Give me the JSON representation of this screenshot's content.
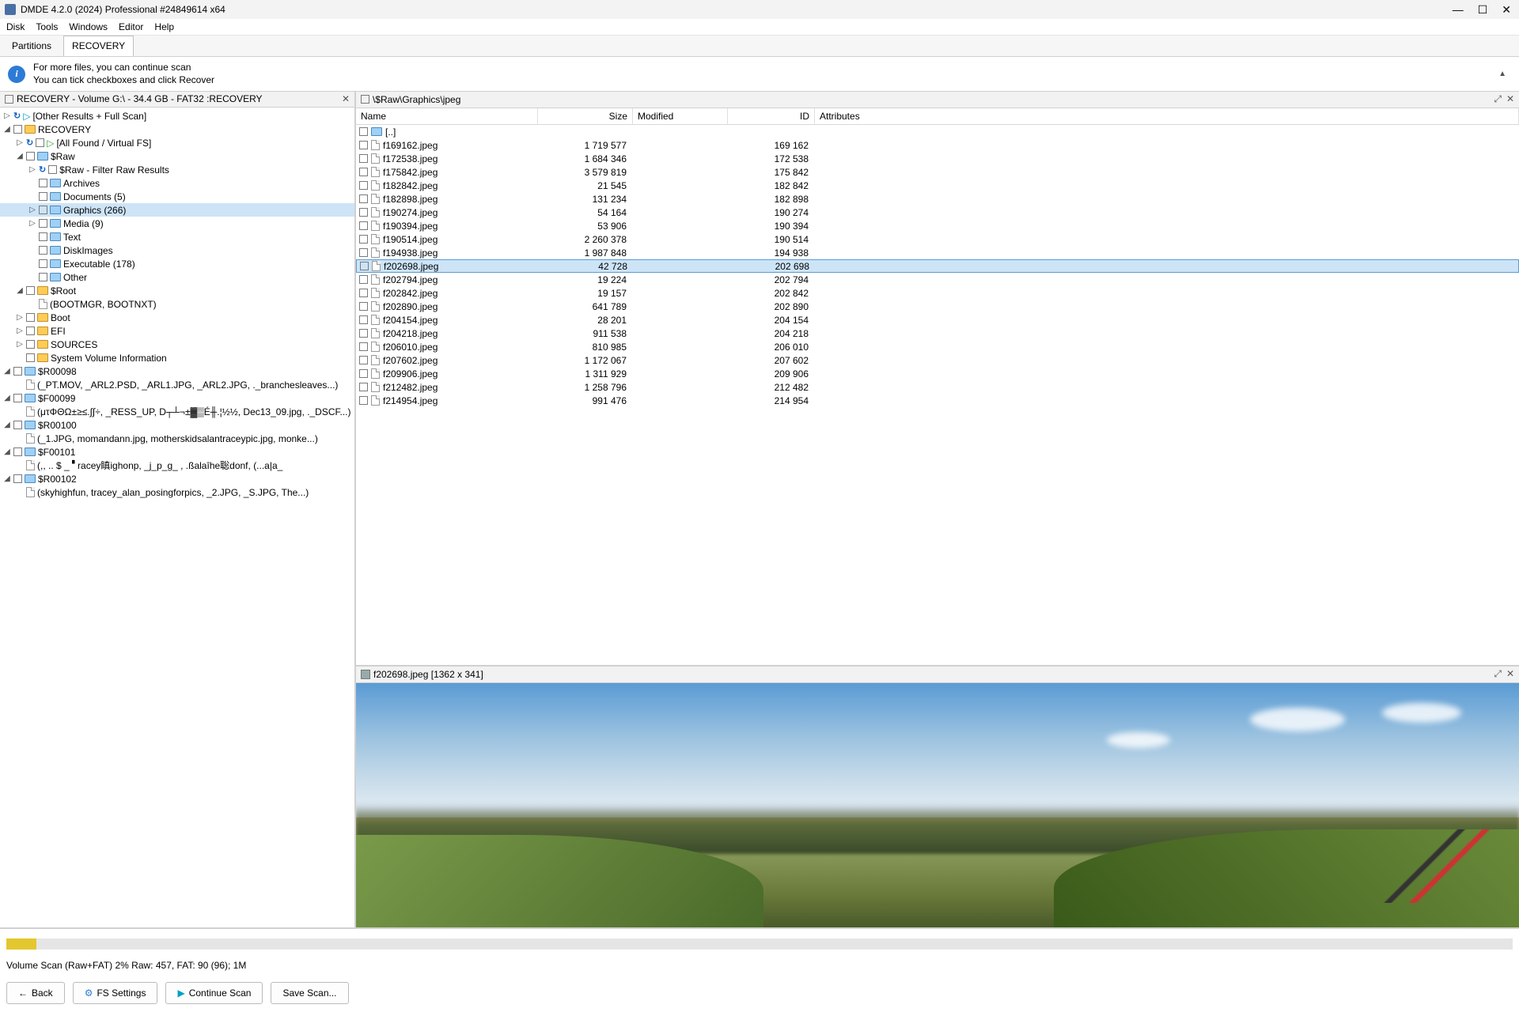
{
  "title": "DMDE 4.2.0 (2024) Professional #24849614 x64",
  "menu": [
    "Disk",
    "Tools",
    "Windows",
    "Editor",
    "Help"
  ],
  "tabs": [
    {
      "label": "Partitions",
      "active": false
    },
    {
      "label": "RECOVERY",
      "active": true
    }
  ],
  "info": {
    "line1": "For more files, you can continue scan",
    "line2": "You can tick checkboxes and click Recover"
  },
  "left": {
    "title": "RECOVERY - Volume G:\\ - 34.4 GB - FAT32 :RECOVERY",
    "rows": [
      {
        "d": 0,
        "t": "▷",
        "extras": [
          "refresh",
          "play"
        ],
        "label": "[Other Results + Full Scan]",
        "folder": false
      },
      {
        "d": 0,
        "t": "◢",
        "chk": true,
        "fld": "gold",
        "label": "RECOVERY"
      },
      {
        "d": 1,
        "t": "▷",
        "extras": [
          "refresh",
          "chk",
          "playg"
        ],
        "label": "[All Found / Virtual FS]"
      },
      {
        "d": 1,
        "t": "◢",
        "chk": true,
        "fld": "blue",
        "label": "$Raw"
      },
      {
        "d": 2,
        "t": "▷",
        "extras": [
          "refresh",
          "chk"
        ],
        "label": "$Raw - Filter Raw Results"
      },
      {
        "d": 2,
        "t": "",
        "chk": true,
        "fld": "blue",
        "label": "Archives"
      },
      {
        "d": 2,
        "t": "",
        "chk": true,
        "fld": "blue",
        "label": "Documents (5)"
      },
      {
        "d": 2,
        "t": "▷",
        "chk": true,
        "fld": "blue",
        "label": "Graphics (266)",
        "sel": true
      },
      {
        "d": 2,
        "t": "▷",
        "chk": true,
        "fld": "blue",
        "label": "Media (9)"
      },
      {
        "d": 2,
        "t": "",
        "chk": true,
        "fld": "blue",
        "label": "Text"
      },
      {
        "d": 2,
        "t": "",
        "chk": true,
        "fld": "blue",
        "label": "DiskImages"
      },
      {
        "d": 2,
        "t": "",
        "chk": true,
        "fld": "blue",
        "label": "Executable (178)"
      },
      {
        "d": 2,
        "t": "",
        "chk": true,
        "fld": "blue",
        "label": "Other"
      },
      {
        "d": 1,
        "t": "◢",
        "chk": true,
        "fld": "gold",
        "label": "$Root"
      },
      {
        "d": 2,
        "t": "",
        "doc": true,
        "label": "(BOOTMGR, BOOTNXT)"
      },
      {
        "d": 1,
        "t": "▷",
        "chk": true,
        "fld": "gold",
        "label": "Boot"
      },
      {
        "d": 1,
        "t": "▷",
        "chk": true,
        "fld": "gold",
        "label": "EFI"
      },
      {
        "d": 1,
        "t": "▷",
        "chk": true,
        "fld": "gold",
        "label": "SOURCES"
      },
      {
        "d": 1,
        "t": "",
        "chk": true,
        "fld": "gold",
        "label": "System Volume Information"
      },
      {
        "d": 0,
        "t": "◢",
        "chk": true,
        "fld": "blue",
        "label": "$R00098"
      },
      {
        "d": 1,
        "t": "",
        "doc": true,
        "label": "(_PT.MOV, _ARL2.PSD, _ARL1.JPG, _ARL2.JPG, ._branchesleaves...)"
      },
      {
        "d": 0,
        "t": "◢",
        "chk": true,
        "fld": "blue",
        "label": "$F00099"
      },
      {
        "d": 1,
        "t": "",
        "doc": true,
        "label": "(μτΦΘΩ±≥≤.∫∫÷, _RESS_UP, D┬┴¬±▓▒É╫.¦½½, Dec13_09.jpg, ._DSCF...)"
      },
      {
        "d": 0,
        "t": "◢",
        "chk": true,
        "fld": "blue",
        "label": "$R00100"
      },
      {
        "d": 1,
        "t": "",
        "doc": true,
        "label": "(_1.JPG, momandann.jpg, motherskidsalantraceypic.jpg, monke...)"
      },
      {
        "d": 0,
        "t": "◢",
        "chk": true,
        "fld": "blue",
        "label": "$F00101"
      },
      {
        "d": 1,
        "t": "",
        "doc": true,
        "label": "(,, .. $ _ 🬀racey瞋ighonp, _j_p_g_ , .ßalaîhe聡donf, (...a|a_"
      },
      {
        "d": 0,
        "t": "◢",
        "chk": true,
        "fld": "blue",
        "label": "$R00102"
      },
      {
        "d": 1,
        "t": "",
        "doc": true,
        "label": "(skyhighfun, tracey_alan_posingforpics, _2.JPG, _S.JPG, The...)"
      }
    ]
  },
  "right": {
    "title": "\\$Raw\\Graphics\\jpeg",
    "cols": {
      "name": "Name",
      "size": "Size",
      "modified": "Modified",
      "id": "ID",
      "attr": "Attributes"
    },
    "uplabel": "[..]",
    "files": [
      {
        "name": "f169162.jpeg",
        "size": "1 719 577",
        "id": "169 162"
      },
      {
        "name": "f172538.jpeg",
        "size": "1 684 346",
        "id": "172 538"
      },
      {
        "name": "f175842.jpeg",
        "size": "3 579 819",
        "id": "175 842"
      },
      {
        "name": "f182842.jpeg",
        "size": "21 545",
        "id": "182 842"
      },
      {
        "name": "f182898.jpeg",
        "size": "131 234",
        "id": "182 898"
      },
      {
        "name": "f190274.jpeg",
        "size": "54 164",
        "id": "190 274"
      },
      {
        "name": "f190394.jpeg",
        "size": "53 906",
        "id": "190 394"
      },
      {
        "name": "f190514.jpeg",
        "size": "2 260 378",
        "id": "190 514"
      },
      {
        "name": "f194938.jpeg",
        "size": "1 987 848",
        "id": "194 938"
      },
      {
        "name": "f202698.jpeg",
        "size": "42 728",
        "id": "202 698",
        "sel": true
      },
      {
        "name": "f202794.jpeg",
        "size": "19 224",
        "id": "202 794"
      },
      {
        "name": "f202842.jpeg",
        "size": "19 157",
        "id": "202 842"
      },
      {
        "name": "f202890.jpeg",
        "size": "641 789",
        "id": "202 890"
      },
      {
        "name": "f204154.jpeg",
        "size": "28 201",
        "id": "204 154"
      },
      {
        "name": "f204218.jpeg",
        "size": "911 538",
        "id": "204 218"
      },
      {
        "name": "f206010.jpeg",
        "size": "810 985",
        "id": "206 010"
      },
      {
        "name": "f207602.jpeg",
        "size": "1 172 067",
        "id": "207 602"
      },
      {
        "name": "f209906.jpeg",
        "size": "1 311 929",
        "id": "209 906"
      },
      {
        "name": "f212482.jpeg",
        "size": "1 258 796",
        "id": "212 482"
      },
      {
        "name": "f214954.jpeg",
        "size": "991 476",
        "id": "214 954"
      }
    ],
    "preview_title": "f202698.jpeg [1362 x 341]"
  },
  "progress_pct": 2,
  "status": "Volume Scan (Raw+FAT) 2% Raw: 457, FAT: 90 (96); 1M",
  "buttons": {
    "back": "Back",
    "fs": "FS Settings",
    "cont": "Continue Scan",
    "save": "Save Scan..."
  }
}
